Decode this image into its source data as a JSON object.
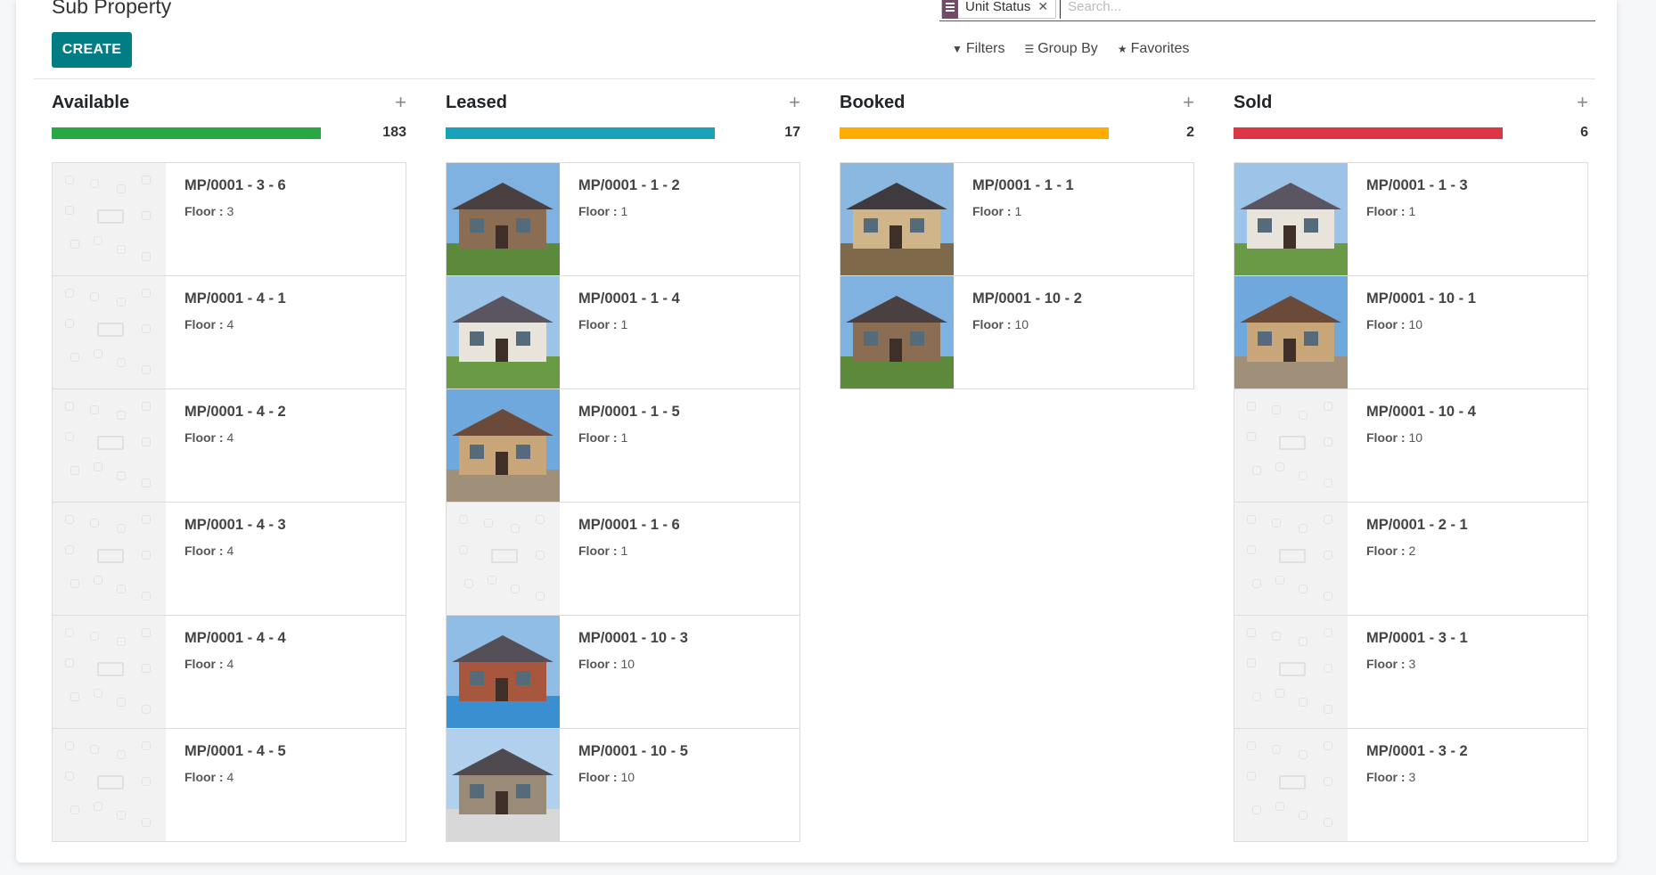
{
  "page": {
    "title": "Sub Property",
    "create_label": "CREATE"
  },
  "search": {
    "facet_label": "Unit Status",
    "facet_remove": "✕",
    "placeholder": "Search...",
    "filters_label": "Filters",
    "groupby_label": "Group By",
    "favorites_label": "Favorites"
  },
  "colors": {
    "accent": "#017e84",
    "available": "#28a745",
    "leased": "#17a2b8",
    "booked": "#ffac00",
    "sold": "#dc3545"
  },
  "columns": [
    {
      "title": "Available",
      "count": "183",
      "cards": [
        {
          "name": "MP/0001 - 3 - 6",
          "floor_label": "Floor :",
          "floor": "3",
          "image": "placeholder"
        },
        {
          "name": "MP/0001 - 4 - 1",
          "floor_label": "Floor :",
          "floor": "4",
          "image": "placeholder"
        },
        {
          "name": "MP/0001 - 4 - 2",
          "floor_label": "Floor :",
          "floor": "4",
          "image": "placeholder"
        },
        {
          "name": "MP/0001 - 4 - 3",
          "floor_label": "Floor :",
          "floor": "4",
          "image": "placeholder"
        },
        {
          "name": "MP/0001 - 4 - 4",
          "floor_label": "Floor :",
          "floor": "4",
          "image": "placeholder"
        },
        {
          "name": "MP/0001 - 4 - 5",
          "floor_label": "Floor :",
          "floor": "4",
          "image": "placeholder"
        }
      ]
    },
    {
      "title": "Leased",
      "count": "17",
      "cards": [
        {
          "name": "MP/0001 - 1 - 2",
          "floor_label": "Floor :",
          "floor": "1",
          "image": "house-photo"
        },
        {
          "name": "MP/0001 - 1 - 4",
          "floor_label": "Floor :",
          "floor": "1",
          "image": "house-photo"
        },
        {
          "name": "MP/0001 - 1 - 5",
          "floor_label": "Floor :",
          "floor": "1",
          "image": "house-photo"
        },
        {
          "name": "MP/0001 - 1 - 6",
          "floor_label": "Floor :",
          "floor": "1",
          "image": "placeholder"
        },
        {
          "name": "MP/0001 - 10 - 3",
          "floor_label": "Floor :",
          "floor": "10",
          "image": "pool-photo"
        },
        {
          "name": "MP/0001 - 10 - 5",
          "floor_label": "Floor :",
          "floor": "10",
          "image": "house-photo"
        }
      ]
    },
    {
      "title": "Booked",
      "count": "2",
      "cards": [
        {
          "name": "MP/0001 - 1 - 1",
          "floor_label": "Floor :",
          "floor": "1",
          "image": "house-photo"
        },
        {
          "name": "MP/0001 - 10 - 2",
          "floor_label": "Floor :",
          "floor": "10",
          "image": "house-photo"
        }
      ]
    },
    {
      "title": "Sold",
      "count": "6",
      "cards": [
        {
          "name": "MP/0001 - 1 - 3",
          "floor_label": "Floor :",
          "floor": "1",
          "image": "house-photo"
        },
        {
          "name": "MP/0001 - 10 - 1",
          "floor_label": "Floor :",
          "floor": "10",
          "image": "house-photo"
        },
        {
          "name": "MP/0001 - 10 - 4",
          "floor_label": "Floor :",
          "floor": "10",
          "image": "placeholder"
        },
        {
          "name": "MP/0001 - 2 - 1",
          "floor_label": "Floor :",
          "floor": "2",
          "image": "placeholder"
        },
        {
          "name": "MP/0001 - 3 - 1",
          "floor_label": "Floor :",
          "floor": "3",
          "image": "placeholder"
        },
        {
          "name": "MP/0001 - 3 - 2",
          "floor_label": "Floor :",
          "floor": "3",
          "image": "placeholder"
        }
      ]
    }
  ]
}
